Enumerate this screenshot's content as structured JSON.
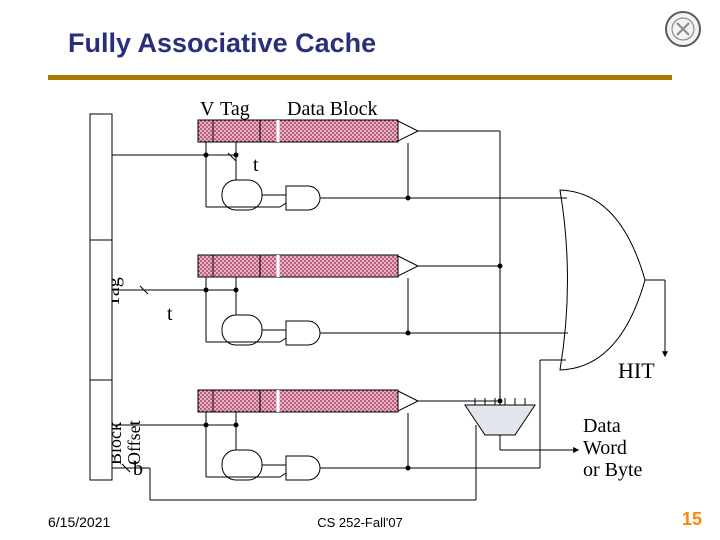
{
  "slide": {
    "title": "Fully Associative Cache",
    "title_size": "27px",
    "accent_color": "#2A2F7A",
    "rule_color": "#A57C00",
    "date": "6/15/2021",
    "course": "CS 252-Fall'07",
    "page_num": "15"
  },
  "labels": {
    "v": "V",
    "tag_col": "Tag",
    "data_block": "Data Block",
    "t_top": "t",
    "t_mid": "t",
    "tag_vert": "Tag",
    "block_offset": "Block\nOffset",
    "b": "b",
    "eq": "=",
    "hit": "HIT",
    "data_word": "Data\nWord\nor Byte"
  },
  "colors": {
    "stipple_fill": "#E7B4B4",
    "stipple_dots": "#9A1F6B",
    "mux_fill": "#E3E6EE",
    "outline": "#000"
  }
}
